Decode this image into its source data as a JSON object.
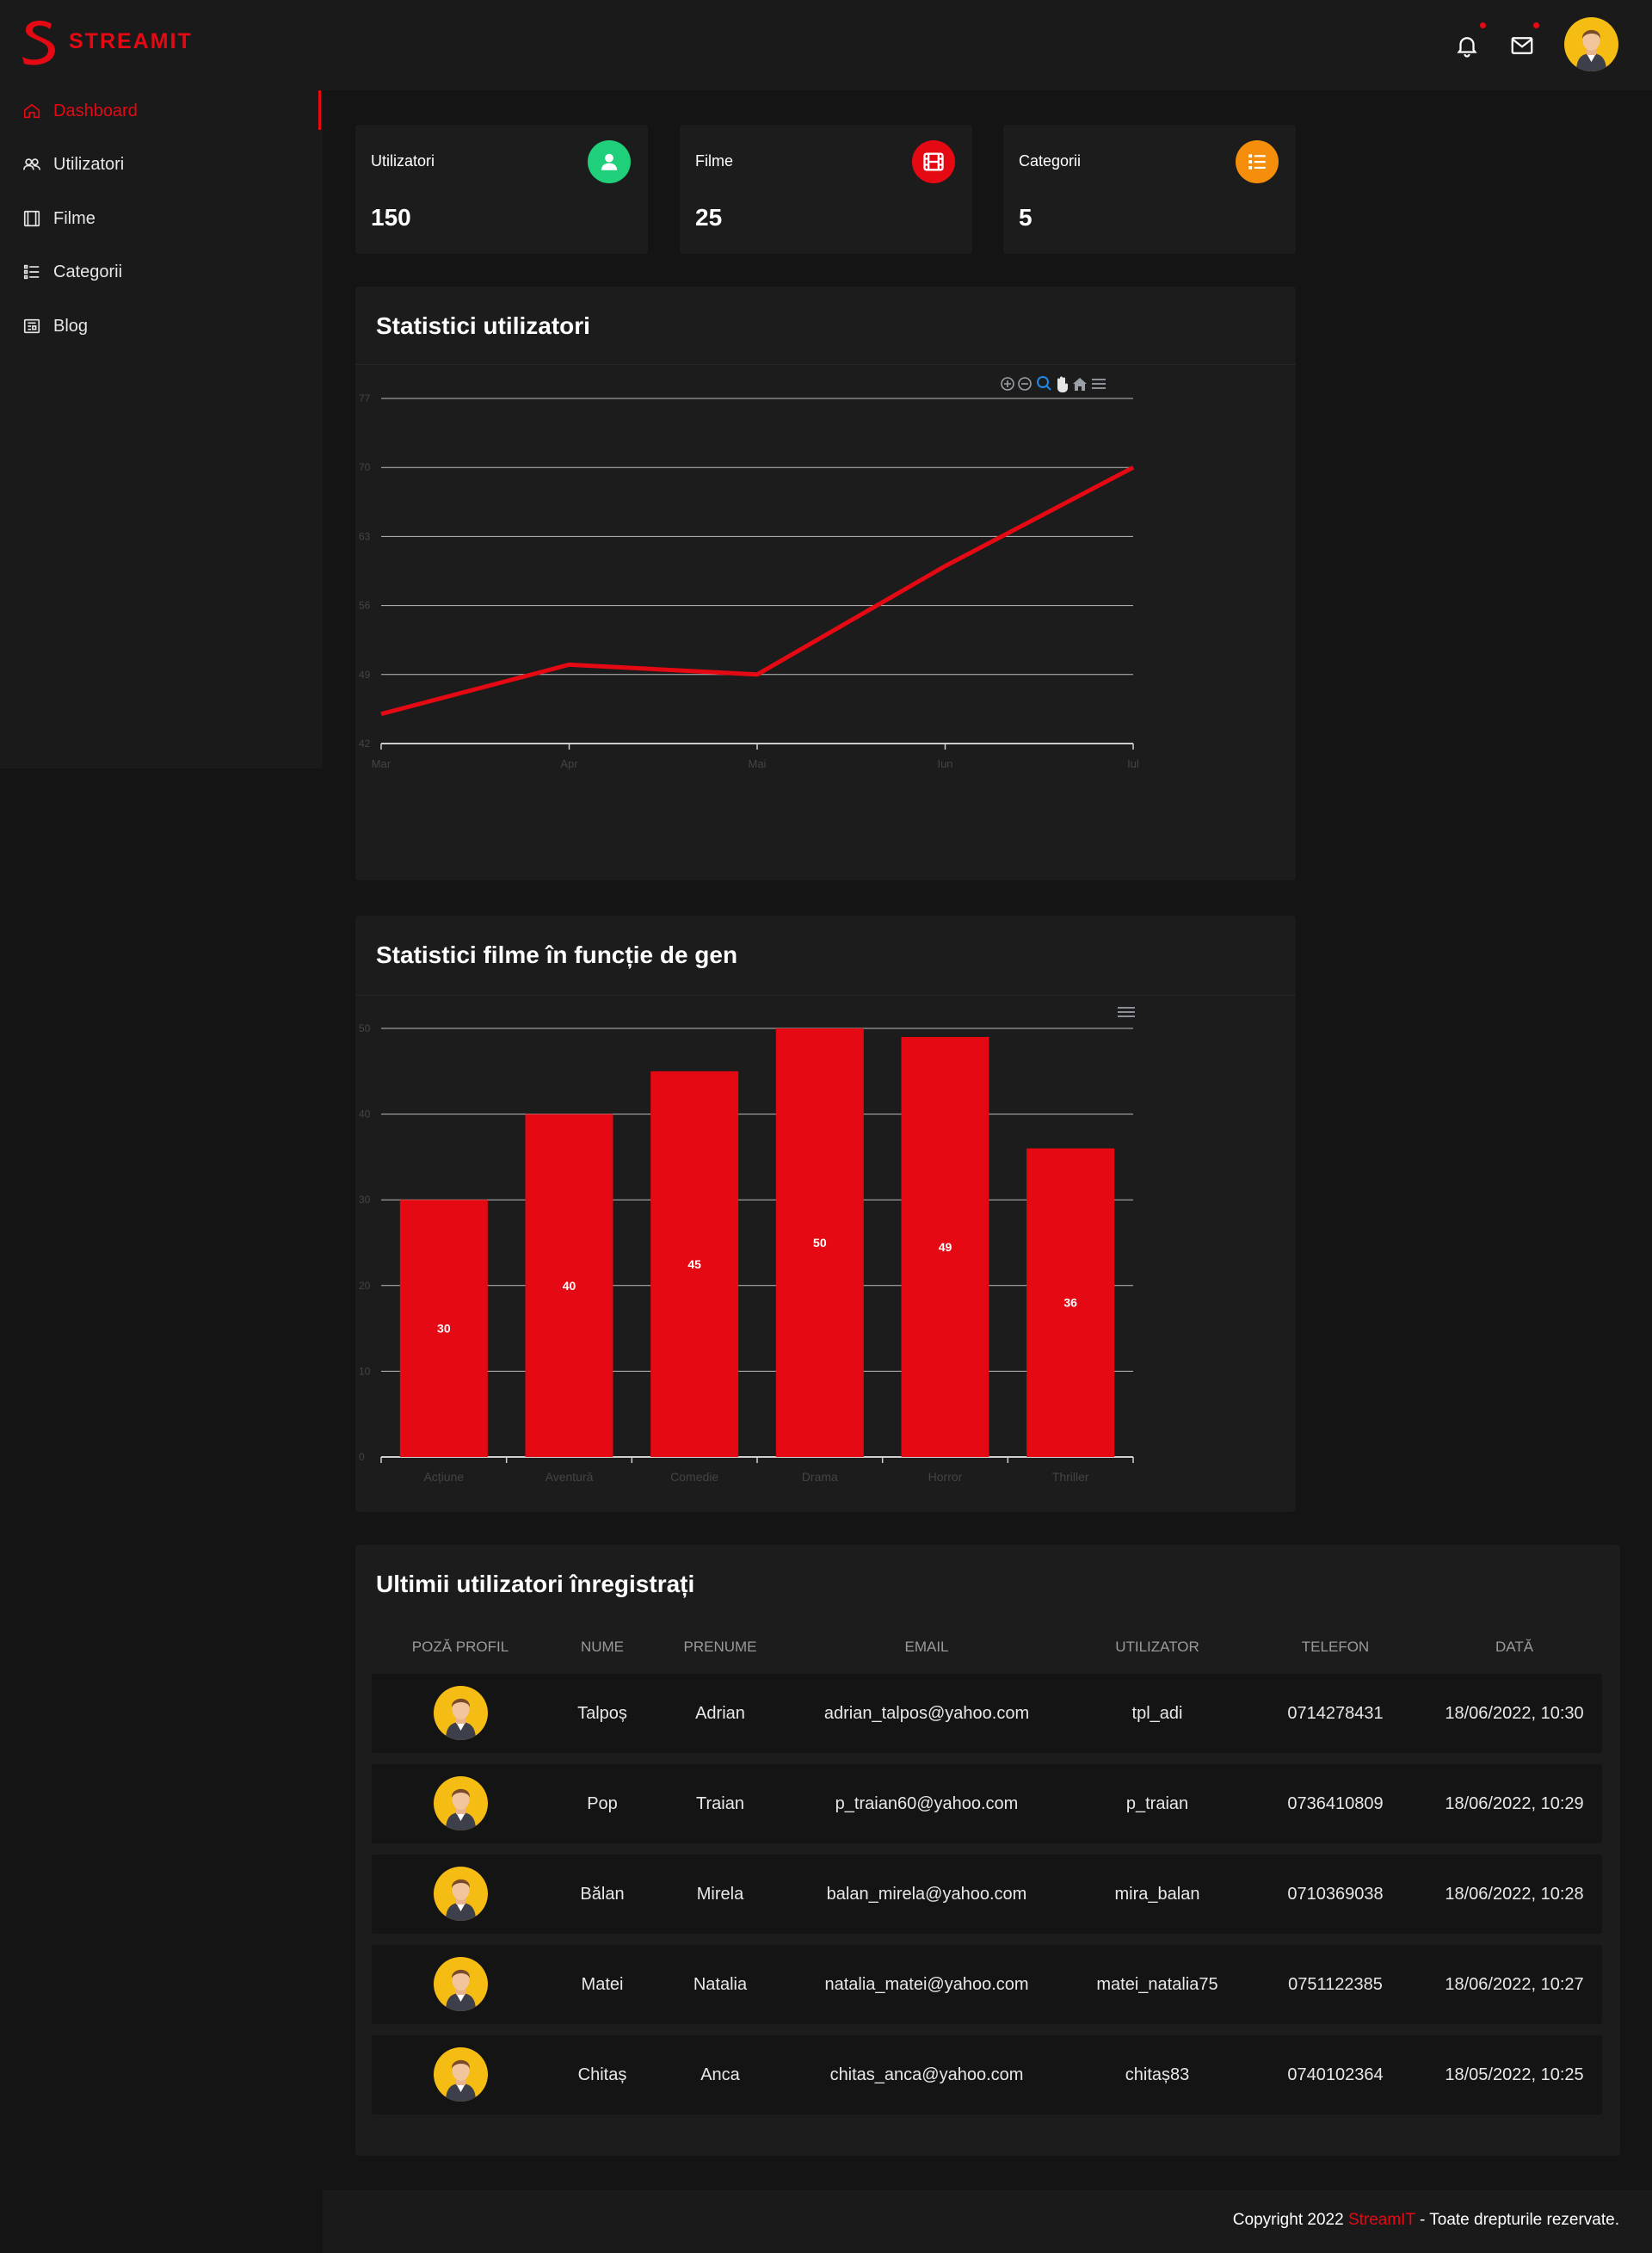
{
  "brand": {
    "name": "STREAMIT",
    "color": "#e50914"
  },
  "header": {
    "icons": [
      "bell-icon",
      "mail-icon"
    ],
    "avatar": "user-avatar"
  },
  "sidebar": {
    "items": [
      {
        "label": "Dashboard",
        "icon": "home-icon",
        "active": true
      },
      {
        "label": "Utilizatori",
        "icon": "users-icon",
        "active": false
      },
      {
        "label": "Filme",
        "icon": "film-icon",
        "active": false
      },
      {
        "label": "Categorii",
        "icon": "list-icon",
        "active": false
      },
      {
        "label": "Blog",
        "icon": "newspaper-icon",
        "active": false
      }
    ]
  },
  "stats": [
    {
      "label": "Utilizatori",
      "value": "150",
      "icon": "user-icon",
      "color": "#1fcf7a"
    },
    {
      "label": "Filme",
      "value": "25",
      "icon": "film-icon",
      "color": "#e50914"
    },
    {
      "label": "Categorii",
      "value": "5",
      "icon": "list-icon",
      "color": "#f58e0b"
    }
  ],
  "line_panel": {
    "title": "Statistici utilizatori"
  },
  "bar_panel": {
    "title": "Statistici filme în funcție de gen"
  },
  "chart_data": [
    {
      "type": "line",
      "x": [
        "Mar",
        "Apr",
        "Mai",
        "Iun",
        "Iul"
      ],
      "series": [
        {
          "values": [
            45,
            50,
            49,
            60,
            70
          ],
          "color": "#e50914"
        }
      ],
      "yticks": [
        42,
        49,
        56,
        63,
        70,
        77
      ],
      "ylim": [
        42,
        77
      ],
      "grid": true
    },
    {
      "type": "bar",
      "categories": [
        "Acțiune",
        "Aventură",
        "Comedie",
        "Drama",
        "Horror",
        "Thriller"
      ],
      "values": [
        30,
        40,
        45,
        50,
        49,
        36
      ],
      "yticks": [
        0,
        10,
        20,
        30,
        40,
        50
      ],
      "ylim": [
        0,
        50
      ],
      "grid": true,
      "color": "#e50914"
    }
  ],
  "users_table": {
    "title": "Ultimii utilizatori înregistrați",
    "columns": [
      "POZĂ PROFIL",
      "NUME",
      "PRENUME",
      "EMAIL",
      "UTILIZATOR",
      "TELEFON",
      "DATĂ"
    ],
    "rows": [
      {
        "nume": "Talpoș",
        "prenume": "Adrian",
        "email": "adrian_talpos@yahoo.com",
        "utilizator": "tpl_adi",
        "telefon": "0714278431",
        "data": "18/06/2022, 10:30"
      },
      {
        "nume": "Pop",
        "prenume": "Traian",
        "email": "p_traian60@yahoo.com",
        "utilizator": "p_traian",
        "telefon": "0736410809",
        "data": "18/06/2022, 10:29"
      },
      {
        "nume": "Bălan",
        "prenume": "Mirela",
        "email": "balan_mirela@yahoo.com",
        "utilizator": "mira_balan",
        "telefon": "0710369038",
        "data": "18/06/2022, 10:28"
      },
      {
        "nume": "Matei",
        "prenume": "Natalia",
        "email": "natalia_matei@yahoo.com",
        "utilizator": "matei_natalia75",
        "telefon": "0751122385",
        "data": "18/06/2022, 10:27"
      },
      {
        "nume": "Chitaș",
        "prenume": "Anca",
        "email": "chitas_anca@yahoo.com",
        "utilizator": "chitaș83",
        "telefon": "0740102364",
        "data": "18/05/2022, 10:25"
      }
    ]
  },
  "footer": {
    "prefix": "Copyright 2022 ",
    "brand": "StreamIT",
    "suffix": " - Toate drepturile rezervate."
  }
}
